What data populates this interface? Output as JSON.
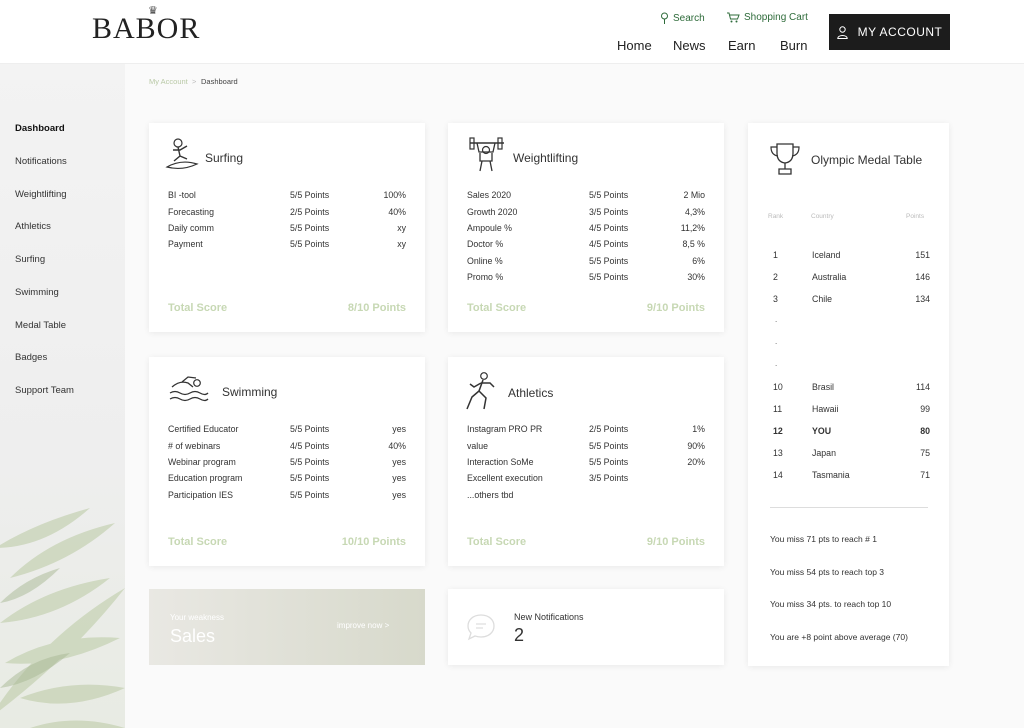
{
  "brand": "BABOR",
  "header": {
    "search_label": "Search",
    "cart_label": "Shopping Cart",
    "nav": [
      "Home",
      "News",
      "Earn",
      "Burn"
    ],
    "account_label": "MY ACCOUNT"
  },
  "sidebar": {
    "items": [
      {
        "label": "Dashboard",
        "active": true
      },
      {
        "label": "Notifications"
      },
      {
        "label": "Weightlifting"
      },
      {
        "label": "Athletics"
      },
      {
        "label": "Surfing"
      },
      {
        "label": "Swimming"
      },
      {
        "label": "Medal Table"
      },
      {
        "label": "Badges"
      },
      {
        "label": "Support Team"
      }
    ]
  },
  "breadcrumb": {
    "parent": "My Account",
    "separator": ">",
    "current": "Dashboard"
  },
  "cards": {
    "surfing": {
      "title": "Surfing",
      "rows": [
        [
          "BI -tool",
          "5/5 Points",
          "100%"
        ],
        [
          "Forecasting",
          "2/5 Points",
          "40%"
        ],
        [
          "Daily comm",
          "5/5 Points",
          "xy"
        ],
        [
          "Payment",
          "5/5 Points",
          "xy"
        ]
      ],
      "total_label": "Total Score",
      "total_value": "8/10 Points"
    },
    "weightlifting": {
      "title": "Weightlifting",
      "rows": [
        [
          "Sales 2020",
          "5/5 Points",
          "2 Mio"
        ],
        [
          "Growth 2020",
          "3/5 Points",
          "4,3%"
        ],
        [
          "Ampoule %",
          "4/5 Points",
          "11,2%"
        ],
        [
          "Doctor %",
          "4/5 Points",
          "8,5 %"
        ],
        [
          "Online %",
          "5/5 Points",
          "6%"
        ],
        [
          "Promo %",
          "5/5 Points",
          "30%"
        ]
      ],
      "total_label": "Total Score",
      "total_value": "9/10 Points"
    },
    "swimming": {
      "title": "Swimming",
      "rows": [
        [
          "Certified Educator",
          "5/5 Points",
          "yes"
        ],
        [
          "# of webinars",
          "4/5 Points",
          "40%"
        ],
        [
          "Webinar program",
          "5/5 Points",
          "yes"
        ],
        [
          "Education program",
          "5/5 Points",
          "yes"
        ],
        [
          "Participation IES",
          "5/5 Points",
          "yes"
        ]
      ],
      "total_label": "Total Score",
      "total_value": "10/10 Points"
    },
    "athletics": {
      "title": "Athletics",
      "rows": [
        [
          "Instagram PRO PR",
          "2/5 Points",
          "1%"
        ],
        [
          "value",
          "5/5 Points",
          "90%"
        ],
        [
          "Interaction SoMe",
          "5/5 Points",
          "20%"
        ],
        [
          "Excellent execution",
          "3/5 Points",
          ""
        ],
        [
          "...others tbd",
          "",
          ""
        ]
      ],
      "total_label": "Total Score",
      "total_value": "9/10 Points"
    }
  },
  "medal_table": {
    "title": "Olympic Medal Table",
    "headers": {
      "rank": "Rank",
      "country": "Country",
      "points": "Points"
    },
    "rows": [
      {
        "rank": "1",
        "country": "Iceland",
        "points": "151"
      },
      {
        "rank": "2",
        "country": "Australia",
        "points": "146"
      },
      {
        "rank": "3",
        "country": "Chile",
        "points": "134"
      },
      {
        "rank": "10",
        "country": "Brasil",
        "points": "114"
      },
      {
        "rank": "11",
        "country": "Hawaii",
        "points": "99"
      },
      {
        "rank": "12",
        "country": "YOU",
        "points": "80",
        "highlight": true
      },
      {
        "rank": "13",
        "country": "Japan",
        "points": "75"
      },
      {
        "rank": "14",
        "country": "Tasmania",
        "points": "71"
      }
    ],
    "gap_marks": [
      ".",
      ".",
      "."
    ],
    "messages": [
      "You miss 71 pts to reach # 1",
      "You miss 54 pts to reach top 3",
      "You miss 34 pts. to reach top 10",
      "You are +8 point above average (70)"
    ]
  },
  "weakness": {
    "label": "Your weakness",
    "value": "Sales",
    "link": "improve now >"
  },
  "notifications": {
    "label": "New Notifications",
    "count": "2"
  },
  "colors": {
    "accent_green": "#2e6b3a",
    "score_green": "#c7d8b4",
    "account_bg": "#1c1c1c"
  }
}
